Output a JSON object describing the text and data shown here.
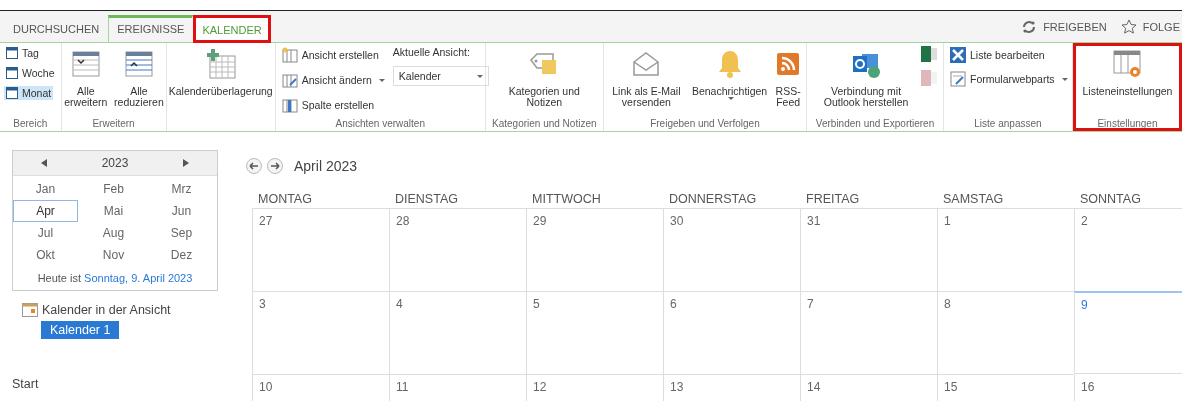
{
  "tabs": [
    {
      "label": "DURCHSUCHEN",
      "selected": false,
      "highlighted": false
    },
    {
      "label": "EREIGNISSE",
      "selected": false,
      "highlighted": false
    },
    {
      "label": "KALENDER",
      "selected": true,
      "highlighted": true
    }
  ],
  "actions": [
    {
      "label": "FREIGEBEN"
    },
    {
      "label": "FOLGE"
    }
  ],
  "ribbon": [
    {
      "label": "Bereich",
      "highlighted": false,
      "items": [
        {
          "kind": "small",
          "label": "Tag",
          "selected": false
        },
        {
          "kind": "small",
          "label": "Woche",
          "selected": false
        },
        {
          "kind": "small",
          "label": "Monat",
          "selected": true
        }
      ]
    },
    {
      "label": "Erweitern",
      "highlighted": false,
      "items": [
        {
          "kind": "large",
          "label": "Alle erweitern"
        },
        {
          "kind": "large",
          "label": "Alle reduzieren"
        }
      ]
    },
    {
      "highlighted": false,
      "items": [
        {
          "kind": "large",
          "label": "Kalenderüberlagerung"
        }
      ]
    },
    {
      "label": "Ansichten verwalten",
      "highlighted": false,
      "items": [
        {
          "kind": "small",
          "label": "Ansicht erstellen",
          "dropdown": false
        },
        {
          "kind": "small",
          "label": "Ansicht ändern",
          "dropdown": true
        },
        {
          "kind": "small",
          "label": "Spalte erstellen",
          "dropdown": false
        },
        {
          "kind": "select",
          "label": "Aktuelle Ansicht:",
          "value": "Kalender"
        }
      ]
    },
    {
      "label": "Kategorien und Notizen",
      "highlighted": false,
      "items": [
        {
          "kind": "large",
          "label": "Kategorien und Notizen"
        }
      ]
    },
    {
      "label": "Freigeben und Verfolgen",
      "highlighted": false,
      "items": [
        {
          "kind": "large",
          "label": "Link als E-Mail versenden"
        },
        {
          "kind": "large",
          "label": "Benachrichtigen",
          "dropdown": true
        },
        {
          "kind": "large",
          "label": "RSS-Feed"
        }
      ]
    },
    {
      "label": "Verbinden und Exportieren",
      "highlighted": false,
      "items": [
        {
          "kind": "large",
          "label": "Verbindung mit Outlook herstellen"
        },
        {
          "kind": "icons",
          "disabled": [
            false,
            true
          ]
        }
      ]
    },
    {
      "label": "Liste anpassen",
      "highlighted": false,
      "items": [
        {
          "kind": "small",
          "label": "Liste bearbeiten",
          "dropdown": false
        },
        {
          "kind": "small",
          "label": "Formularwebparts",
          "dropdown": true
        }
      ]
    },
    {
      "label": "Einstellungen",
      "highlighted": true,
      "items": [
        {
          "kind": "large",
          "label": "Listeneinstellungen"
        }
      ]
    }
  ],
  "date_picker": {
    "year": "2023",
    "months": [
      {
        "label": "Jan",
        "selected": false
      },
      {
        "label": "Feb",
        "selected": false
      },
      {
        "label": "Mrz",
        "selected": false
      },
      {
        "label": "Apr",
        "selected": true
      },
      {
        "label": "Mai",
        "selected": false
      },
      {
        "label": "Jun",
        "selected": false
      },
      {
        "label": "Jul",
        "selected": false
      },
      {
        "label": "Aug",
        "selected": false
      },
      {
        "label": "Sep",
        "selected": false
      },
      {
        "label": "Okt",
        "selected": false
      },
      {
        "label": "Nov",
        "selected": false
      },
      {
        "label": "Dez",
        "selected": false
      }
    ],
    "today_prefix": "Heute ist",
    "today_link": "Sonntag, 9. April 2023"
  },
  "calendars_in_view": {
    "title": "Kalender in der Ansicht",
    "items": [
      {
        "label": "Kalender 1",
        "selected": true
      }
    ]
  },
  "nav": [
    {
      "label": "Start"
    }
  ],
  "calendar": {
    "title": "April 2023",
    "weekdays": [
      "MONTAG",
      "DIENSTAG",
      "MITTWOCH",
      "DONNERSTAG",
      "FREITAG",
      "SAMSTAG",
      "SONNTAG"
    ],
    "weeks": [
      [
        {
          "day": "27",
          "today": false
        },
        {
          "day": "28",
          "today": false
        },
        {
          "day": "29",
          "today": false
        },
        {
          "day": "30",
          "today": false
        },
        {
          "day": "31",
          "today": false
        },
        {
          "day": "1",
          "today": false
        },
        {
          "day": "2",
          "today": false
        }
      ],
      [
        {
          "day": "3",
          "today": false
        },
        {
          "day": "4",
          "today": false
        },
        {
          "day": "5",
          "today": false
        },
        {
          "day": "6",
          "today": false
        },
        {
          "day": "7",
          "today": false
        },
        {
          "day": "8",
          "today": false
        },
        {
          "day": "9",
          "today": true
        }
      ],
      [
        {
          "day": "10",
          "today": false
        },
        {
          "day": "11",
          "today": false
        },
        {
          "day": "12",
          "today": false
        },
        {
          "day": "13",
          "today": false
        },
        {
          "day": "14",
          "today": false
        },
        {
          "day": "15",
          "today": false
        },
        {
          "day": "16",
          "today": false
        }
      ]
    ]
  }
}
